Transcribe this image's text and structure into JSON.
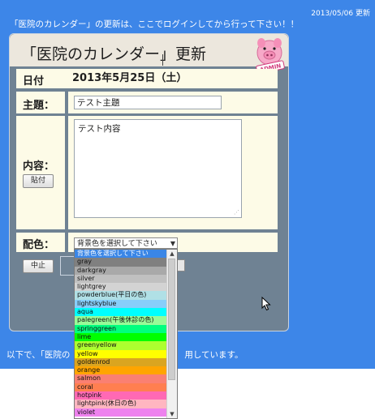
{
  "header": {
    "date_stamp": "2013/05/06 更新",
    "notice": "「医院のカレンダー」の更新は、ここでログインしてから行って下さい！！"
  },
  "panel": {
    "title": "「医院のカレンダー」更新",
    "admin_badge": "ADMIN"
  },
  "form": {
    "date_label": "日付",
    "date_value": "2013年5月25日（土）",
    "subject_label": "主題：",
    "subject_value": "テスト主題",
    "content_label": "内容：",
    "content_value": "テスト内容",
    "paste_button": "貼付",
    "color_label": "配色：",
    "color_placeholder": "背景色を選択して下さい",
    "cancel_button": "中止"
  },
  "dropdown": {
    "options": [
      {
        "label": "背景色を選択して下さい",
        "color": "#3a86e6",
        "selected": true
      },
      {
        "label": "gray",
        "color": "#808080"
      },
      {
        "label": "darkgray",
        "color": "#a9a9a9"
      },
      {
        "label": "silver",
        "color": "#c0c0c0"
      },
      {
        "label": "lightgrey",
        "color": "#d3d3d3"
      },
      {
        "label": "powderblue(平日の色)",
        "color": "#b0e0e6"
      },
      {
        "label": "lightskyblue",
        "color": "#87cefa"
      },
      {
        "label": "aqua",
        "color": "#00ffff"
      },
      {
        "label": "palegreen(午後休診の色)",
        "color": "#98fb98"
      },
      {
        "label": "springgreen",
        "color": "#00ff7f"
      },
      {
        "label": "lime",
        "color": "#00ff00"
      },
      {
        "label": "greenyellow",
        "color": "#adff2f"
      },
      {
        "label": "yellow",
        "color": "#ffff00"
      },
      {
        "label": "goldenrod",
        "color": "#daa520"
      },
      {
        "label": "orange",
        "color": "#ffa500"
      },
      {
        "label": "salmon",
        "color": "#fa8072"
      },
      {
        "label": "coral",
        "color": "#ff7f50"
      },
      {
        "label": "hotpink",
        "color": "#ff69b4"
      },
      {
        "label": "lightpink(休日の色)",
        "color": "#ffb6c1"
      },
      {
        "label": "violet",
        "color": "#ee82ee"
      }
    ]
  },
  "footer": {
    "text_left": "以下で、「医院の",
    "text_right": "用しています。"
  },
  "colors": {
    "page_background": "#3d86e8",
    "panel_background": "#6f8293",
    "panel_header": "#ece7dd",
    "form_cell": "#fdfbe7"
  }
}
